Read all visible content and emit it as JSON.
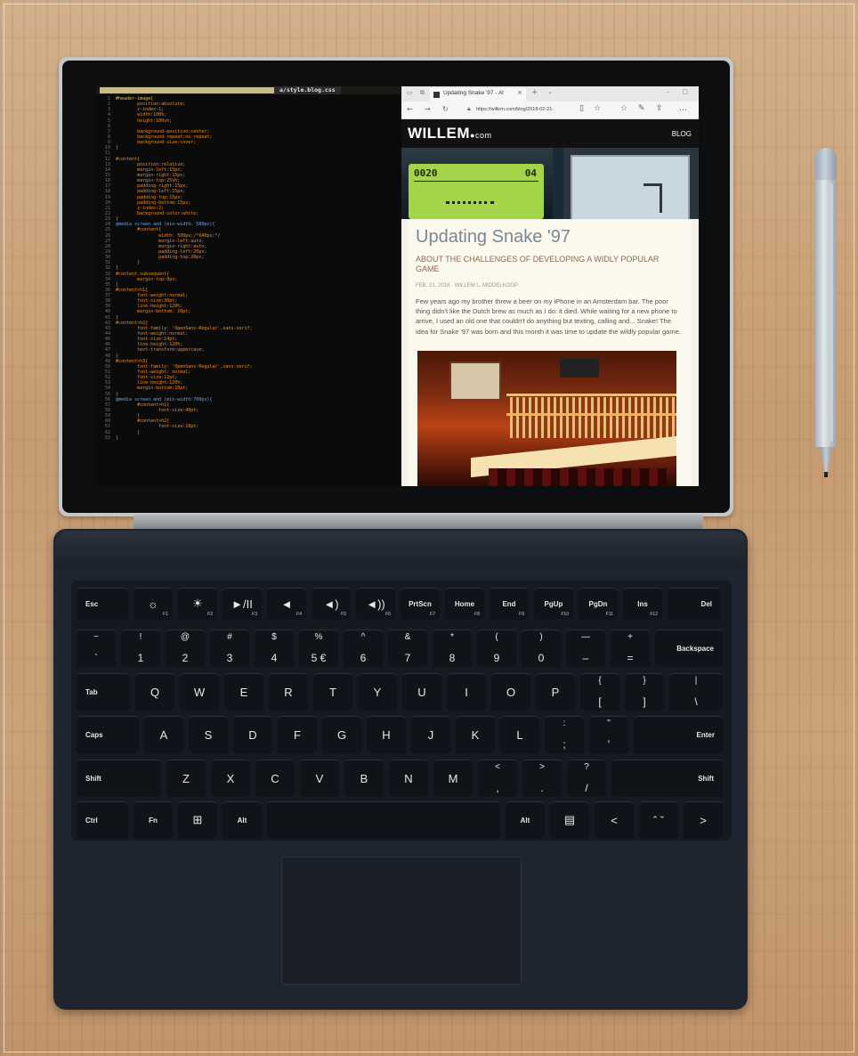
{
  "editor": {
    "tab_active": "a/style.blog.css",
    "lines": [
      {
        "n": "1",
        "t": "#header-image{"
      },
      {
        "n": "2",
        "t": "        position:absolute;"
      },
      {
        "n": "3",
        "t": "        z-index:1;"
      },
      {
        "n": "4",
        "t": "        width:100%;"
      },
      {
        "n": "5",
        "t": "        height:100vh;"
      },
      {
        "n": "6",
        "t": ""
      },
      {
        "n": "7",
        "t": "        background-position:center;"
      },
      {
        "n": "8",
        "t": "        background-repeat:no-repeat;"
      },
      {
        "n": "9",
        "t": "        background-size:cover;"
      },
      {
        "n": "10",
        "t": "}"
      },
      {
        "n": "11",
        "t": ""
      },
      {
        "n": "12",
        "t": "#content{"
      },
      {
        "n": "13",
        "t": "        position:relative;"
      },
      {
        "n": "14",
        "t": "        margin-left:15px;"
      },
      {
        "n": "15",
        "t": "        margin-right:15px;"
      },
      {
        "n": "16",
        "t": "        margin-top:25vh;"
      },
      {
        "n": "17",
        "t": "        padding-right:15px;"
      },
      {
        "n": "18",
        "t": "        padding-left:15px;"
      },
      {
        "n": "19",
        "t": "        padding-top:15px;"
      },
      {
        "n": "20",
        "t": "        padding-bottom:15px;"
      },
      {
        "n": "21",
        "t": "        z-index:2;"
      },
      {
        "n": "22",
        "t": "        background-color:white;"
      },
      {
        "n": "23",
        "t": "}"
      },
      {
        "n": "24",
        "t": "@media screen and (min-width: 500px){"
      },
      {
        "n": "25",
        "t": "        #content{"
      },
      {
        "n": "26",
        "t": "                width: 500px;/*640px;*/"
      },
      {
        "n": "27",
        "t": "                margin-left:auto;"
      },
      {
        "n": "28",
        "t": "                margin-right:auto;"
      },
      {
        "n": "29",
        "t": "                padding-left:20px;"
      },
      {
        "n": "30",
        "t": "                padding-top:20px;"
      },
      {
        "n": "31",
        "t": "        }"
      },
      {
        "n": "32",
        "t": "}"
      },
      {
        "n": "33",
        "t": "#content.subsequent{"
      },
      {
        "n": "34",
        "t": "        margin-top:0px;"
      },
      {
        "n": "35",
        "t": "}"
      },
      {
        "n": "36",
        "t": "#content>h1{"
      },
      {
        "n": "37",
        "t": "        font-weight:normal;"
      },
      {
        "n": "38",
        "t": "        font-size:30pt;"
      },
      {
        "n": "39",
        "t": "        line-height:120%;"
      },
      {
        "n": "40",
        "t": "        margin-bottom: 10pt;"
      },
      {
        "n": "41",
        "t": "}"
      },
      {
        "n": "42",
        "t": "#content>h2{"
      },
      {
        "n": "43",
        "t": "        font-family: 'OpenSans-Regular',sans-serif;"
      },
      {
        "n": "44",
        "t": "        font-weight:normal;"
      },
      {
        "n": "45",
        "t": "        font-size:14pt;"
      },
      {
        "n": "46",
        "t": "        line-height:120%;"
      },
      {
        "n": "47",
        "t": "        text-transform:uppercase;"
      },
      {
        "n": "48",
        "t": "}"
      },
      {
        "n": "49",
        "t": "#content>h3{"
      },
      {
        "n": "50",
        "t": "        font-family: 'OpenSans-Regular',sans-serif;"
      },
      {
        "n": "51",
        "t": "        font-weight: normal;"
      },
      {
        "n": "52",
        "t": "        font-size:12pt;"
      },
      {
        "n": "53",
        "t": "        line-height:120%;"
      },
      {
        "n": "54",
        "t": "        margin-bottom:10pt;"
      },
      {
        "n": "55",
        "t": "}"
      },
      {
        "n": "56",
        "t": "@media screen and (min-width:700px){"
      },
      {
        "n": "57",
        "t": "        #content>h1{"
      },
      {
        "n": "58",
        "t": "                font-size:40pt;"
      },
      {
        "n": "59",
        "t": "        }"
      },
      {
        "n": "60",
        "t": "        #content>h2{"
      },
      {
        "n": "61",
        "t": "                font-size:18pt;"
      },
      {
        "n": "62",
        "t": "        }"
      },
      {
        "n": "63",
        "t": "}"
      }
    ]
  },
  "browser": {
    "tab_title": "Updating Snake '97 - Al",
    "url": "https://willem.com/blog/2018-02-21-",
    "site_logo": "WILLEM",
    "site_logo_suffix": "●com",
    "nav_blog": "BLOG",
    "lcd_score": "0020",
    "lcd_lives": "04",
    "article_title": "Updating Snake '97",
    "article_subtitle": "ABOUT THE CHALLENGES OF DEVELOPING A WIDLY POPULAR GAME",
    "article_meta": "FEB. 21, 2018 · WILLEM L. MIDDELKOOP",
    "article_body": "Few years ago my brother threw a beer on my iPhone in an Amsterdam bar. The poor thing didn't like the Dutch brew as much as I do: it died. While waiting for a new phone to arrive, I used an old one that couldn't do anything but texting, calling and... Snake! The idea for Snake '97 was born and this month it was time to update the wildly popular game."
  },
  "keyboard": {
    "rows": [
      [
        {
          "name": "esc",
          "label": "Esc",
          "w": 58
        },
        {
          "name": "f1",
          "label": "☼",
          "fn": "F1",
          "w": 44
        },
        {
          "name": "f2",
          "label": "☀",
          "fn": "F2",
          "w": 44
        },
        {
          "name": "f3",
          "label": "►/II",
          "fn": "F3",
          "w": 44
        },
        {
          "name": "f4",
          "label": "◄",
          "fn": "F4",
          "w": 44
        },
        {
          "name": "f5",
          "label": "◄)",
          "fn": "F5",
          "w": 44
        },
        {
          "name": "f6",
          "label": "◄))",
          "fn": "F6",
          "w": 44
        },
        {
          "name": "f7",
          "label": "PrtScn",
          "fn": "F7",
          "w": 44
        },
        {
          "name": "f8",
          "label": "Home",
          "fn": "F8",
          "w": 44
        },
        {
          "name": "f9",
          "label": "End",
          "fn": "F9",
          "w": 44
        },
        {
          "name": "f10",
          "label": "PgUp",
          "fn": "F10",
          "w": 44
        },
        {
          "name": "f11",
          "label": "PgDn",
          "fn": "F11",
          "w": 44
        },
        {
          "name": "f12",
          "label": "Ins",
          "fn": "F12",
          "w": 44
        },
        {
          "name": "del",
          "label": "Del",
          "w": 60
        }
      ],
      [
        {
          "name": "tilde",
          "top": "~",
          "bot": "`",
          "w": 44
        },
        {
          "name": "1",
          "top": "!",
          "bot": "1",
          "w": 44
        },
        {
          "name": "2",
          "top": "@",
          "bot": "2",
          "w": 44
        },
        {
          "name": "3",
          "top": "#",
          "bot": "3",
          "w": 44
        },
        {
          "name": "4",
          "top": "$",
          "bot": "4",
          "w": 44
        },
        {
          "name": "5",
          "top": "%",
          "bot": "5 €",
          "w": 44
        },
        {
          "name": "6",
          "top": "^",
          "bot": "6",
          "w": 44
        },
        {
          "name": "7",
          "top": "&",
          "bot": "7",
          "w": 44
        },
        {
          "name": "8",
          "top": "*",
          "bot": "8",
          "w": 44
        },
        {
          "name": "9",
          "top": "(",
          "bot": "9",
          "w": 44
        },
        {
          "name": "0",
          "top": ")",
          "bot": "0",
          "w": 44
        },
        {
          "name": "minus",
          "top": "—",
          "bot": "–",
          "w": 44
        },
        {
          "name": "equals",
          "top": "+",
          "bot": "=",
          "w": 44
        },
        {
          "name": "backspace",
          "label": "Backspace",
          "w": 76
        }
      ],
      [
        {
          "name": "tab",
          "label": "Tab",
          "w": 60
        },
        {
          "name": "q",
          "label": "Q",
          "w": 44
        },
        {
          "name": "w",
          "label": "W",
          "w": 44
        },
        {
          "name": "e",
          "label": "E",
          "w": 44
        },
        {
          "name": "r",
          "label": "R",
          "w": 44
        },
        {
          "name": "t",
          "label": "T",
          "w": 44
        },
        {
          "name": "y",
          "label": "Y",
          "w": 44
        },
        {
          "name": "u",
          "label": "U",
          "w": 44
        },
        {
          "name": "i",
          "label": "I",
          "w": 44
        },
        {
          "name": "o",
          "label": "O",
          "w": 44
        },
        {
          "name": "p",
          "label": "P",
          "w": 44
        },
        {
          "name": "lbracket",
          "top": "{",
          "bot": "[",
          "w": 44
        },
        {
          "name": "rbracket",
          "top": "}",
          "bot": "]",
          "w": 44
        },
        {
          "name": "backslash",
          "top": "|",
          "bot": "\\",
          "w": 60
        }
      ],
      [
        {
          "name": "caps",
          "label": "Caps",
          "w": 70
        },
        {
          "name": "a",
          "label": "A",
          "w": 44
        },
        {
          "name": "s",
          "label": "S",
          "w": 44
        },
        {
          "name": "d",
          "label": "D",
          "w": 44
        },
        {
          "name": "f",
          "label": "F",
          "w": 44
        },
        {
          "name": "g",
          "label": "G",
          "w": 44
        },
        {
          "name": "h",
          "label": "H",
          "w": 44
        },
        {
          "name": "j",
          "label": "J",
          "w": 44
        },
        {
          "name": "k",
          "label": "K",
          "w": 44
        },
        {
          "name": "l",
          "label": "L",
          "w": 44
        },
        {
          "name": "semicolon",
          "top": ":",
          "bot": ";",
          "w": 44
        },
        {
          "name": "quote",
          "top": "\"",
          "bot": "'",
          "w": 44
        },
        {
          "name": "enter",
          "label": "Enter",
          "w": 100
        }
      ],
      [
        {
          "name": "lshift",
          "label": "Shift",
          "w": 94
        },
        {
          "name": "z",
          "label": "Z",
          "w": 44
        },
        {
          "name": "x",
          "label": "X",
          "w": 44
        },
        {
          "name": "c",
          "label": "C",
          "w": 44
        },
        {
          "name": "v",
          "label": "V",
          "w": 44
        },
        {
          "name": "b",
          "label": "B",
          "w": 44
        },
        {
          "name": "n",
          "label": "N",
          "w": 44
        },
        {
          "name": "m",
          "label": "M",
          "w": 44
        },
        {
          "name": "comma",
          "top": "<",
          "bot": ",",
          "w": 44
        },
        {
          "name": "period",
          "top": ">",
          "bot": ".",
          "w": 44
        },
        {
          "name": "slash",
          "top": "?",
          "bot": "/",
          "w": 44
        },
        {
          "name": "rshift",
          "label": "Shift",
          "w": 124
        }
      ],
      [
        {
          "name": "ctrl",
          "label": "Ctrl",
          "w": 58
        },
        {
          "name": "fn",
          "label": "Fn",
          "w": 44
        },
        {
          "name": "win",
          "label": "⊞",
          "w": 44
        },
        {
          "name": "lalt",
          "label": "Alt",
          "w": 44
        },
        {
          "name": "space",
          "label": "",
          "w": 260
        },
        {
          "name": "ralt",
          "label": "Alt",
          "w": 44
        },
        {
          "name": "menu",
          "label": "▤",
          "w": 44
        },
        {
          "name": "left",
          "label": "<",
          "w": 44
        },
        {
          "name": "updown",
          "label": "ˆ ˇ",
          "w": 44
        },
        {
          "name": "right",
          "label": ">",
          "w": 44
        }
      ]
    ]
  }
}
